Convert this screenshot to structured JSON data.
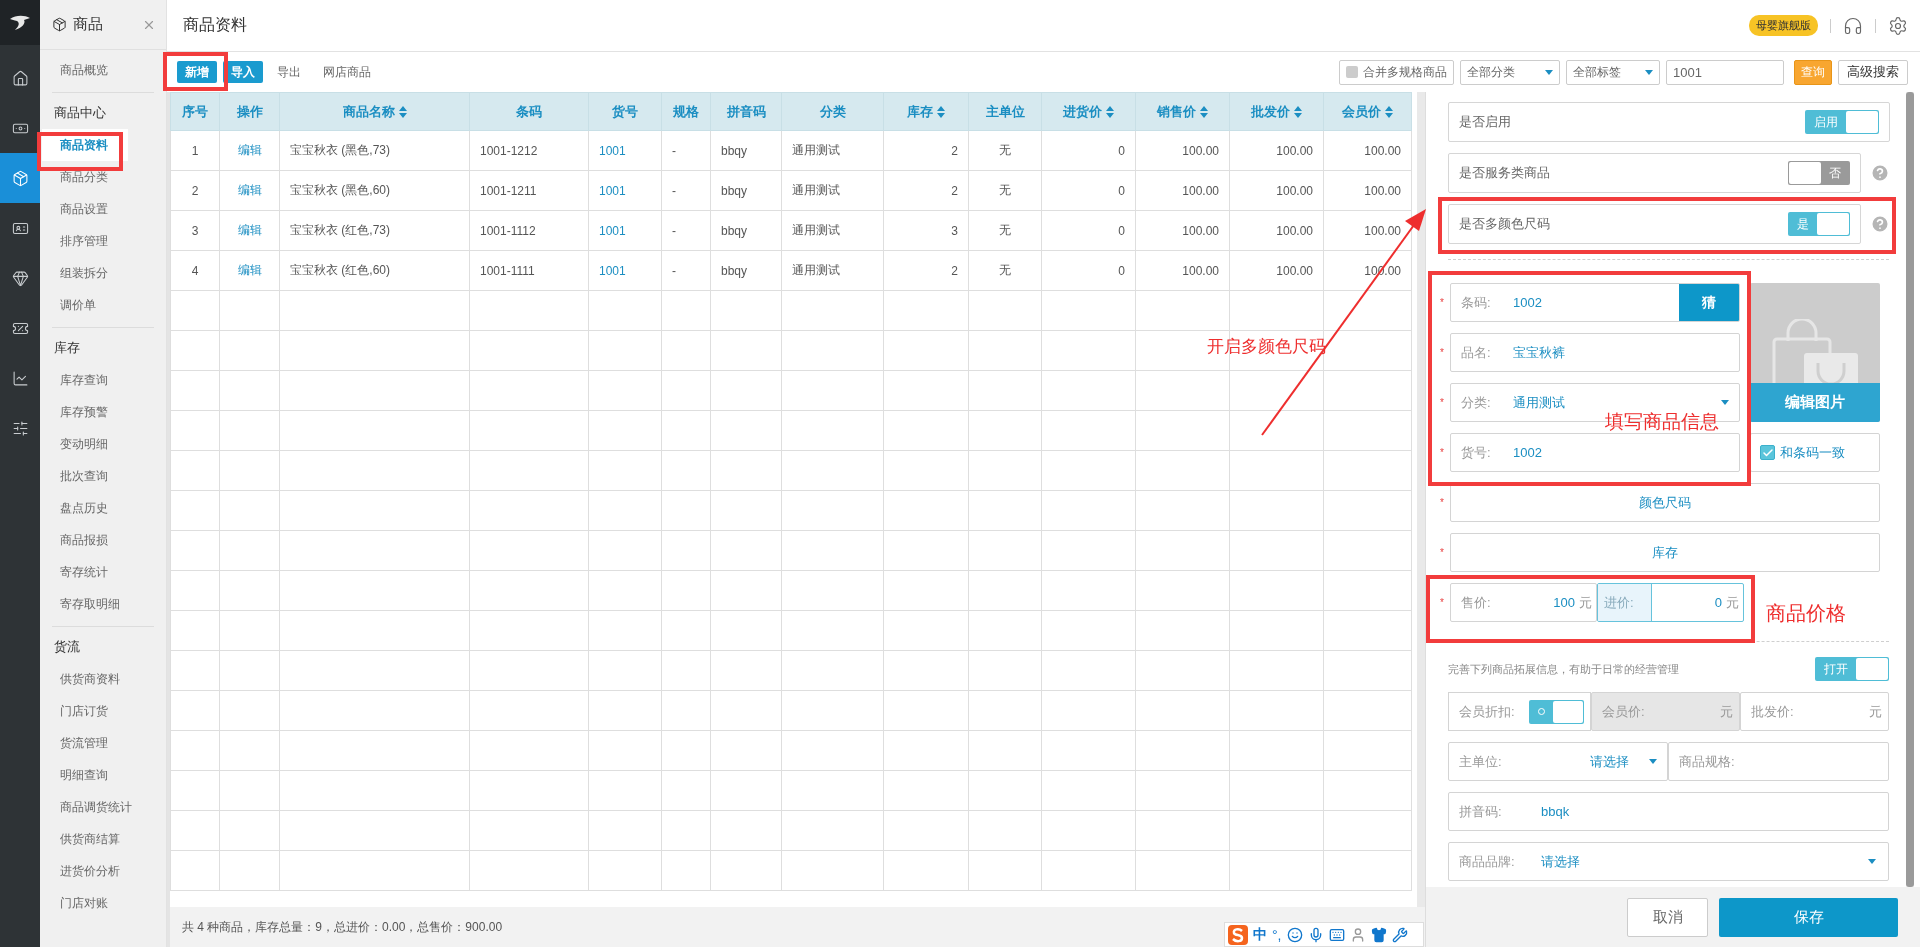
{
  "rail": [
    {
      "kind": "home",
      "selected": false
    },
    {
      "kind": "money",
      "selected": false
    },
    {
      "kind": "box",
      "selected": true
    },
    {
      "kind": "card",
      "selected": false
    },
    {
      "kind": "gem",
      "selected": false
    },
    {
      "kind": "coupon",
      "selected": false
    },
    {
      "kind": "chart",
      "selected": false
    },
    {
      "kind": "sliders",
      "selected": false
    }
  ],
  "sidebar": {
    "title": "商品",
    "groups": [
      {
        "items": [
          {
            "label": "商品概览",
            "selected": false
          }
        ]
      },
      {
        "heading": "商品中心",
        "items": [
          {
            "label": "商品资料",
            "selected": true
          },
          {
            "label": "商品分类",
            "selected": false
          },
          {
            "label": "商品设置",
            "selected": false
          },
          {
            "label": "排序管理",
            "selected": false
          },
          {
            "label": "组装拆分",
            "selected": false
          },
          {
            "label": "调价单",
            "selected": false
          }
        ]
      },
      {
        "heading": "库存",
        "items": [
          {
            "label": "库存查询",
            "selected": false
          },
          {
            "label": "库存预警",
            "selected": false
          },
          {
            "label": "变动明细",
            "selected": false
          },
          {
            "label": "批次查询",
            "selected": false
          },
          {
            "label": "盘点历史",
            "selected": false
          },
          {
            "label": "商品报损",
            "selected": false
          },
          {
            "label": "寄存统计",
            "selected": false
          },
          {
            "label": "寄存取明细",
            "selected": false
          }
        ]
      },
      {
        "heading": "货流",
        "items": [
          {
            "label": "供货商资料",
            "selected": false
          },
          {
            "label": "门店订货",
            "selected": false
          },
          {
            "label": "货流管理",
            "selected": false
          },
          {
            "label": "明细查询",
            "selected": false
          },
          {
            "label": "商品调货统计",
            "selected": false
          },
          {
            "label": "供货商结算",
            "selected": false
          },
          {
            "label": "进货价分析",
            "selected": false
          },
          {
            "label": "门店对账",
            "selected": false
          }
        ]
      }
    ]
  },
  "header": {
    "title": "商品资料",
    "edition_badge": "母婴旗舰版"
  },
  "toolbar": {
    "buttons": [
      {
        "label": "新增",
        "kind": "primary"
      },
      {
        "label": "导入",
        "kind": "primary"
      },
      {
        "label": "导出",
        "kind": "link"
      },
      {
        "label": "网店商品",
        "kind": "link"
      }
    ],
    "merge_checkbox": {
      "label": "合并多规格商品",
      "checked": false
    },
    "category_select": "全部分类",
    "tag_select": "全部标签",
    "search": {
      "value": "1001"
    },
    "query_button": "查询",
    "advanced_button": "高级搜索"
  },
  "table": {
    "columns": [
      {
        "label": "序号",
        "sortable": false,
        "kind": "text"
      },
      {
        "label": "操作",
        "sortable": false,
        "kind": "link"
      },
      {
        "label": "商品名称",
        "sortable": true,
        "kind": "text"
      },
      {
        "label": "条码",
        "sortable": false,
        "kind": "text"
      },
      {
        "label": "货号",
        "sortable": false,
        "kind": "link"
      },
      {
        "label": "规格",
        "sortable": false,
        "kind": "text"
      },
      {
        "label": "拼音码",
        "sortable": false,
        "kind": "text"
      },
      {
        "label": "分类",
        "sortable": false,
        "kind": "text"
      },
      {
        "label": "库存",
        "sortable": true,
        "kind": "text"
      },
      {
        "label": "主单位",
        "sortable": false,
        "kind": "text"
      },
      {
        "label": "进货价",
        "sortable": true,
        "kind": "text"
      },
      {
        "label": "销售价",
        "sortable": true,
        "kind": "text"
      },
      {
        "label": "批发价",
        "sortable": true,
        "kind": "text"
      },
      {
        "label": "会员价",
        "sortable": true,
        "kind": "text"
      }
    ],
    "rows": [
      [
        "1",
        "编辑",
        "宝宝秋衣 (黑色,73)",
        "1001-1212",
        "1001",
        "-",
        "bbqy",
        "通用测试",
        "2",
        "无",
        "0",
        "100.00",
        "100.00",
        "100.00"
      ],
      [
        "2",
        "编辑",
        "宝宝秋衣 (黑色,60)",
        "1001-1211",
        "1001",
        "-",
        "bbqy",
        "通用测试",
        "2",
        "无",
        "0",
        "100.00",
        "100.00",
        "100.00"
      ],
      [
        "3",
        "编辑",
        "宝宝秋衣 (红色,73)",
        "1001-1112",
        "1001",
        "-",
        "bbqy",
        "通用测试",
        "3",
        "无",
        "0",
        "100.00",
        "100.00",
        "100.00"
      ],
      [
        "4",
        "编辑",
        "宝宝秋衣 (红色,60)",
        "1001-1111",
        "1001",
        "-",
        "bbqy",
        "通用测试",
        "2",
        "无",
        "0",
        "100.00",
        "100.00",
        "100.00"
      ]
    ],
    "summary": "共 4 种商品，库存总量：9，总进价：0.00，总售价：900.00"
  },
  "panel": {
    "settings": [
      {
        "label": "是否启用",
        "text": "启用",
        "on": true,
        "help": false
      },
      {
        "label": "是否服务类商品",
        "text": "否",
        "on": false,
        "help": true
      },
      {
        "label": "是否多颜色尺码",
        "text": "是",
        "on": true,
        "help": true
      }
    ],
    "form": {
      "barcode": {
        "required_mark": "*",
        "label": "条码:",
        "value": "1002",
        "button": "猜"
      },
      "name": {
        "required_mark": "*",
        "label": "品名:",
        "value": "宝宝秋裤"
      },
      "category": {
        "required_mark": "*",
        "label": "分类:",
        "value": "通用测试"
      },
      "item_no": {
        "required_mark": "*",
        "label": "货号:",
        "value": "1002"
      },
      "image_button": "编辑图片",
      "same_as_barcode": {
        "label": "和条码一致",
        "checked": true
      },
      "color_size": {
        "required_mark": "*",
        "label": "颜色尺码"
      },
      "stock": {
        "required_mark": "*",
        "label": "库存"
      },
      "price": {
        "required_mark": "*",
        "sale_label": "售价:",
        "sale_value": "100",
        "sale_unit": "元",
        "purchase_label": "进价:",
        "purchase_value": "0",
        "purchase_unit": "元"
      }
    },
    "extended": {
      "hint": "完善下列商品拓展信息，有助于日常的经营管理",
      "toggle": {
        "text": "打开",
        "on": true
      },
      "member_discount": {
        "label": "会员折扣:",
        "on": true
      },
      "member_price": {
        "label": "会员价:",
        "unit": "元",
        "disabled": true
      },
      "wholesale_price": {
        "label": "批发价:",
        "unit": "元",
        "disabled": false
      },
      "unit": {
        "label": "主单位:",
        "value": "请选择"
      },
      "spec": {
        "label": "商品规格:"
      },
      "pinyin": {
        "label": "拼音码:",
        "value": "bbqk"
      },
      "brand": {
        "label": "商品品牌:",
        "value": "请选择"
      }
    },
    "footer": {
      "cancel": "取消",
      "save": "保存"
    }
  },
  "annotations": [
    "开启多颜色尺码",
    "填写商品信息",
    "商品价格"
  ],
  "ime_bar": {
    "mode": "中",
    "punctuation": "°,"
  }
}
